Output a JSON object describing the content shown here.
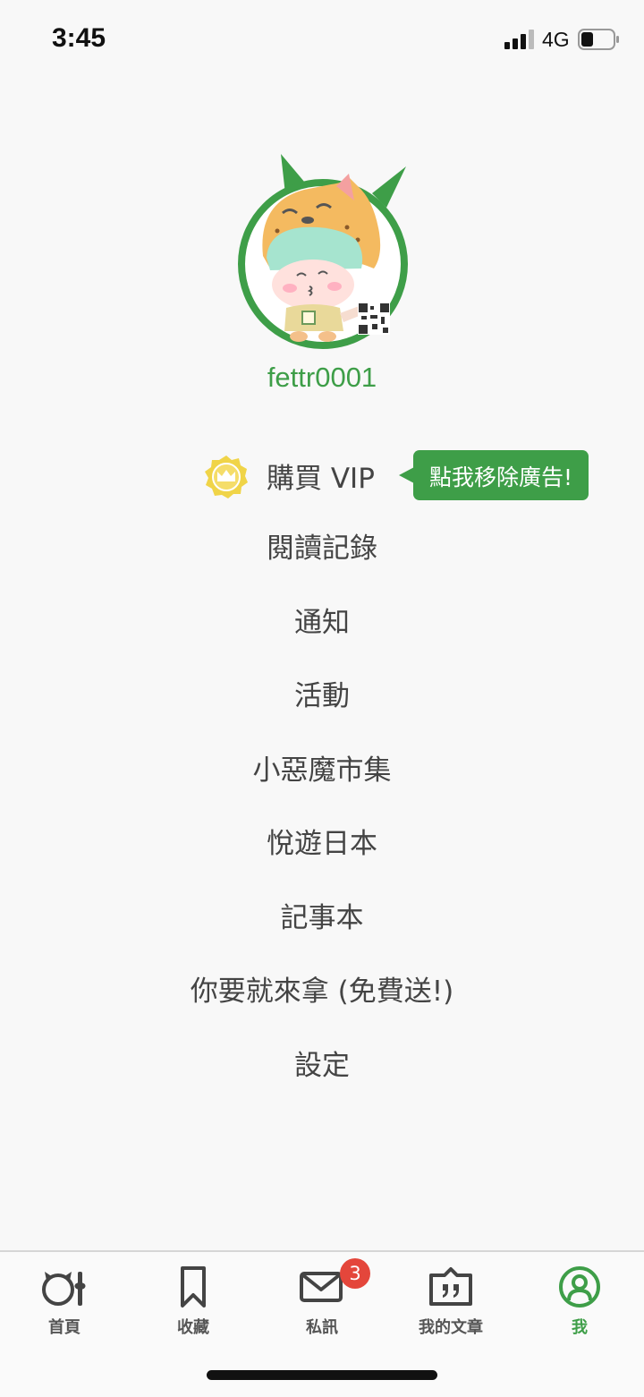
{
  "status_bar": {
    "time": "3:45",
    "network": "4G"
  },
  "profile": {
    "username": "fettr0001"
  },
  "vip": {
    "label": "購買 VIP",
    "bubble": "點我移除廣告!"
  },
  "menu": [
    {
      "label": "閱讀記錄"
    },
    {
      "label": "通知"
    },
    {
      "label": "活動"
    },
    {
      "label": "小惡魔市集"
    },
    {
      "label": "悅遊日本"
    },
    {
      "label": "記事本"
    },
    {
      "label": "你要就來拿 (免費送!)"
    },
    {
      "label": "設定"
    }
  ],
  "tabs": [
    {
      "label": "首頁",
      "icon": "home-icon"
    },
    {
      "label": "收藏",
      "icon": "bookmark-icon"
    },
    {
      "label": "私訊",
      "icon": "mail-icon",
      "badge": "3"
    },
    {
      "label": "我的文章",
      "icon": "quote-icon"
    },
    {
      "label": "我",
      "icon": "profile-icon",
      "active": true
    }
  ],
  "colors": {
    "accent": "#3e9e48",
    "vip_gold": "#f0d448",
    "badge": "#e4463b",
    "text": "#444444"
  }
}
